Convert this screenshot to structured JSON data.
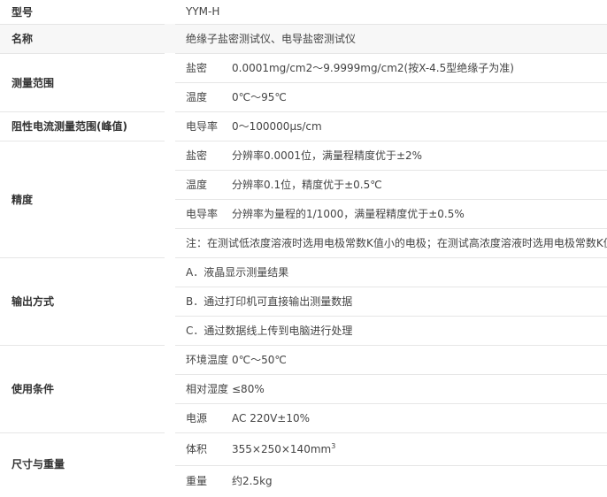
{
  "rows": {
    "model": {
      "label": "型号",
      "value": "YYM-H"
    },
    "name": {
      "label": "名称",
      "value": "绝缘子盐密测试仪、电导盐密测试仪"
    },
    "range": {
      "label": "测量范围",
      "items": [
        {
          "key": "盐密",
          "value": "0.0001mg/cm2～9.9999mg/cm2(按X-4.5型绝缘子为准)"
        },
        {
          "key": "温度",
          "value": "0℃～95℃"
        }
      ]
    },
    "resistance": {
      "label": "阻性电流测量范围(峰值)",
      "key": "电导率",
      "value": "0～100000μs/cm"
    },
    "accuracy": {
      "label": "精度",
      "items": [
        {
          "key": "盐密",
          "value": "分辨率0.0001位，满量程精度优于±2%"
        },
        {
          "key": "温度",
          "value": "分辨率0.1位，精度优于±0.5℃"
        },
        {
          "key": "电导率",
          "value": "分辨率为量程的1/1000，满量程精度优于±0.5%"
        }
      ],
      "note": "注：在测试低浓度溶液时选用电极常数K值小的电极；在测试高浓度溶液时选用电极常数K值大的电极"
    },
    "output": {
      "label": "输出方式",
      "items": [
        "A．液晶显示测量结果",
        "B．通过打印机可直接输出测量数据",
        "C．通过数据线上传到电脑进行处理"
      ]
    },
    "conditions": {
      "label": "使用条件",
      "items": [
        {
          "key": "环境温度",
          "value": "0℃～50℃"
        },
        {
          "key": "相对湿度",
          "value": "≤80%"
        },
        {
          "key": "电源",
          "value": "AC 220V±10%"
        }
      ]
    },
    "size": {
      "label": "尺寸与重量",
      "volume_key": "体积",
      "volume_value": "355×250×140mm",
      "volume_sup": "3",
      "weight_key": "重量",
      "weight_value": "约2.5kg"
    }
  }
}
